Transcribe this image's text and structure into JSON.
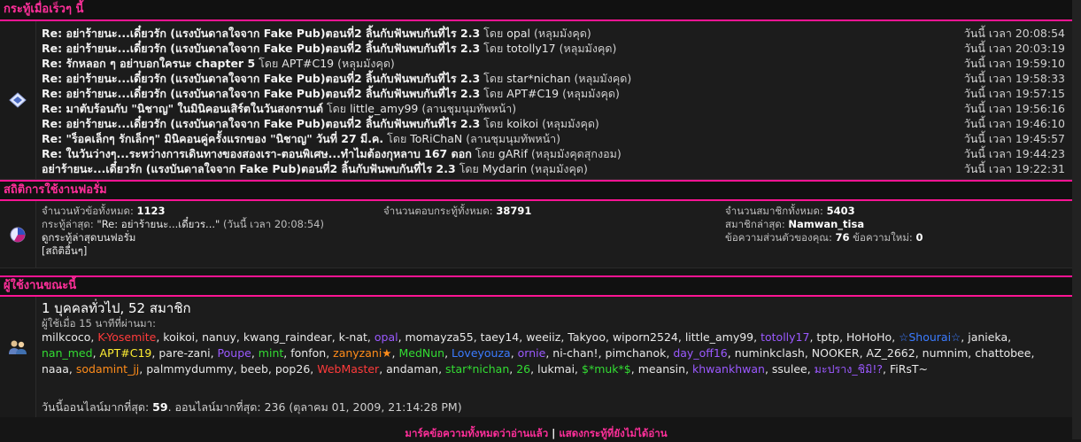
{
  "recent": {
    "title": "กระทู้เมื่อเร็วๆ นี้",
    "posts": [
      {
        "title": "Re: อย่าร้ายนะ...เดี๋ยวรัก (แรงบันดาลใจจาก Fake Pub)ตอนที่2 ลิ้นกับฟันพบกันที่ไร 2.3",
        "by": "โดย",
        "user": "opal",
        "forum": "(หลุมมังคุด)",
        "date": "วันนี้ เวลา 20:08:54"
      },
      {
        "title": "Re: อย่าร้ายนะ...เดี๋ยวรัก (แรงบันดาลใจจาก Fake Pub)ตอนที่2 ลิ้นกับฟันพบกันที่ไร 2.3",
        "by": "โดย",
        "user": "totolly17",
        "forum": "(หลุมมังคุด)",
        "date": "วันนี้ เวลา 20:03:19"
      },
      {
        "title": "Re: รักหลอก ๆ อย่าบอกใครนะ chapter 5",
        "by": "โดย",
        "user": "APT#C19",
        "forum": "(หลุมมังคุด)",
        "date": "วันนี้ เวลา 19:59:10"
      },
      {
        "title": "Re: อย่าร้ายนะ...เดี๋ยวรัก (แรงบันดาลใจจาก Fake Pub)ตอนที่2 ลิ้นกับฟันพบกันที่ไร 2.3",
        "by": "โดย",
        "user": "star*nichan",
        "forum": "(หลุมมังคุด)",
        "date": "วันนี้ เวลา 19:58:33"
      },
      {
        "title": "Re: อย่าร้ายนะ...เดี๋ยวรัก (แรงบันดาลใจจาก Fake Pub)ตอนที่2 ลิ้นกับฟันพบกันที่ไร 2.3",
        "by": "โดย",
        "user": "APT#C19",
        "forum": "(หลุมมังคุด)",
        "date": "วันนี้ เวลา 19:57:15"
      },
      {
        "title": "Re: มาตับร้อนกับ \"นิชาญ\" ในมินิคอนเสิร์ตในวันสงกรานต์",
        "by": "โดย",
        "user": "little_amy99",
        "forum": "(ลานชุมนุมทัพหน้า)",
        "date": "วันนี้ เวลา 19:56:16"
      },
      {
        "title": "Re: อย่าร้ายนะ...เดี๋ยวรัก (แรงบันดาลใจจาก Fake Pub)ตอนที่2 ลิ้นกับฟันพบกันที่ไร 2.3",
        "by": "โดย",
        "user": "koikoi",
        "forum": "(หลุมมังคุด)",
        "date": "วันนี้ เวลา 19:46:10"
      },
      {
        "title": "Re: \"ร็อคเล็กๆ รักเล็กๆ\" มินิคอนคู่ครั้งแรกของ \"นิชาญ\" วันที่ 27 มี.ค.",
        "by": "โดย",
        "user": "ToRiChaN",
        "forum": "(ลานชุมนุมทัพหน้า)",
        "date": "วันนี้ เวลา 19:45:57"
      },
      {
        "title": "Re: ในวันว่างๆ...ระหว่างการเดินทางของสองเรา-ตอนพิเศษ...ทำไมต้องกุหลาบ 167 ดอก",
        "by": "โดย",
        "user": "gARif",
        "forum": "(หลุมมังคุดสุกงอม)",
        "date": "วันนี้ เวลา 19:44:23"
      },
      {
        "title": "อย่าร้ายนะ...เดี๋ยวรัก (แรงบันดาลใจจาก Fake Pub)ตอนที่2 ลิ้นกับฟันพบกันที่ไร 2.3",
        "by": "โดย",
        "user": "Mydarin",
        "forum": "(หลุมมังคุด)",
        "date": "วันนี้ เวลา 19:22:31"
      }
    ]
  },
  "stats": {
    "title": "สถิติการใช้งานฟอรั่ม",
    "topics_label": "จำนวนหัวข้อทั้งหมด:",
    "topics": "1123",
    "posts_label": "จำนวนตอบกระทู้ทั้งหมด:",
    "posts": "38791",
    "members_label": "จำนวนสมาชิกทั้งหมด:",
    "members": "5403",
    "latest_post_label": "กระทู้ล่าสุด:",
    "latest_post": "\"Re: อย่าร้ายนะ...เดี๋ยวร...\"",
    "latest_post_time": "(วันนี้ เวลา 20:08:54)",
    "latest_member_label": "สมาชิกล่าสุด:",
    "latest_member": "Namwan_tisa",
    "view_recent": "ดูกระทู้ล่าสุดบนฟอรั่ม",
    "pm_label": "ข้อความส่วนตัวของคุณ:",
    "pm_count": "76",
    "pm_new_label": "ข้อความใหม่:",
    "pm_new": "0",
    "more_stats": "[สถิติอื่นๆ]"
  },
  "online": {
    "title": "ผู้ใช้งานขณะนี้",
    "summary": "1 บุคคลทั่วไป, 52 สมาชิก",
    "sub": "ผู้ใช้เมื่อ 15 นาทีที่ผ่านมา:",
    "users": [
      {
        "name": "milkcoco",
        "color": "#e8e8e8"
      },
      {
        "name": "K-Yosemite",
        "color": "#ff3b3b"
      },
      {
        "name": "koikoi",
        "color": "#e8e8e8"
      },
      {
        "name": "nanuy",
        "color": "#e8e8e8"
      },
      {
        "name": "kwang_raindear",
        "color": "#e8e8e8"
      },
      {
        "name": "k-nat",
        "color": "#e8e8e8"
      },
      {
        "name": "opal",
        "color": "#9b59ff"
      },
      {
        "name": "momayza55",
        "color": "#e8e8e8"
      },
      {
        "name": "taey14",
        "color": "#e8e8e8"
      },
      {
        "name": "weeiiz",
        "color": "#e8e8e8"
      },
      {
        "name": "Takyoo",
        "color": "#e8e8e8"
      },
      {
        "name": "wiporn2524",
        "color": "#e8e8e8"
      },
      {
        "name": "little_amy99",
        "color": "#e8e8e8"
      },
      {
        "name": "totolly17",
        "color": "#9b59ff"
      },
      {
        "name": "tptp",
        "color": "#e8e8e8"
      },
      {
        "name": "HoHoHo",
        "color": "#e8e8e8"
      },
      {
        "name": "☆Shourai☆",
        "color": "#3b7bff"
      },
      {
        "name": "janieka",
        "color": "#e8e8e8"
      },
      {
        "name": "nan_med",
        "color": "#33dd33"
      },
      {
        "name": "APT#C19",
        "color": "#ffee33"
      },
      {
        "name": "pare-zani",
        "color": "#e8e8e8"
      },
      {
        "name": "Poupe",
        "color": "#9b59ff"
      },
      {
        "name": "mint",
        "color": "#33dd33"
      },
      {
        "name": "fonfon",
        "color": "#e8e8e8"
      },
      {
        "name": "zanyzani★",
        "color": "#ff8c1a"
      },
      {
        "name": "MedNun",
        "color": "#33dd33"
      },
      {
        "name": "Loveyouza",
        "color": "#3b7bff"
      },
      {
        "name": "ornie",
        "color": "#9b59ff"
      },
      {
        "name": "ni-chan!",
        "color": "#e8e8e8"
      },
      {
        "name": "pimchanok",
        "color": "#e8e8e8"
      },
      {
        "name": "day_off16",
        "color": "#9b59ff"
      },
      {
        "name": "numinkclash",
        "color": "#e8e8e8"
      },
      {
        "name": "NOOKER",
        "color": "#e8e8e8"
      },
      {
        "name": "AZ_2662",
        "color": "#e8e8e8"
      },
      {
        "name": "numnim",
        "color": "#e8e8e8"
      },
      {
        "name": "chattobee",
        "color": "#e8e8e8"
      },
      {
        "name": "naaa",
        "color": "#e8e8e8"
      },
      {
        "name": "sodamint_jj",
        "color": "#ff8c1a"
      },
      {
        "name": "palmmydummy",
        "color": "#e8e8e8"
      },
      {
        "name": "beeb",
        "color": "#e8e8e8"
      },
      {
        "name": "pop26",
        "color": "#e8e8e8"
      },
      {
        "name": "WebMaster",
        "color": "#ff3b3b"
      },
      {
        "name": "andaman",
        "color": "#e8e8e8"
      },
      {
        "name": "star*nichan",
        "color": "#33dd33"
      },
      {
        "name": "26",
        "color": "#33dd33"
      },
      {
        "name": "lukmai",
        "color": "#e8e8e8"
      },
      {
        "name": "$*muk*$",
        "color": "#33dd33"
      },
      {
        "name": "meansin",
        "color": "#e8e8e8"
      },
      {
        "name": "khwankhwan",
        "color": "#9b59ff"
      },
      {
        "name": "ssulee",
        "color": "#e8e8e8"
      },
      {
        "name": "มะปราง_ชิมิ!?",
        "color": "#9b59ff"
      },
      {
        "name": "FiRsT~",
        "color": "#e8e8e8"
      }
    ],
    "record_prefix": "วันนี้ออนไลน์มากที่สุด:",
    "record_today": "59",
    "record_mid": ". ออนไลน์มากที่สุด: 236 (ตุลาคม 01, 2009, 21:14:28 PM)"
  },
  "footer": {
    "mark_read": "มาร์คข้อความทั้งหมดว่าอ่านแล้ว",
    "sep": "|",
    "show_unread": "แสดงกระทู้ที่ยังไม่ได้อ่าน"
  },
  "colors": {
    "accent": "#ff1493",
    "accent_text": "#ff2f9a"
  }
}
